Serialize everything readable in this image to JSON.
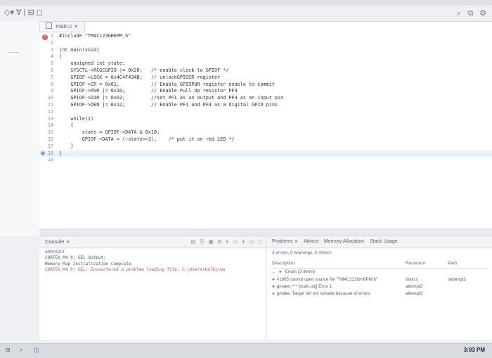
{
  "toolbar": {
    "left_controls": "◇▾ ∀ | ⊟ ◻",
    "right_controls": [
      "⌕",
      "⧉",
      "⚙"
    ]
  },
  "editor": {
    "tab_label": "main.c ⨯",
    "lines": [
      {
        "num": "1",
        "text": "#include \"TM4C123GH6PM.h\""
      },
      {
        "num": "2",
        "text": ""
      },
      {
        "num": "3",
        "text": "int main(void)"
      },
      {
        "num": "4",
        "text": "{"
      },
      {
        "num": "5",
        "text": "    unsigned int state;"
      },
      {
        "num": "6",
        "text": "    SYSCTL->RCGCGPIO |= 0x20;   /* enable clock to GPIOF */"
      },
      {
        "num": "7",
        "text": "    GPIOF->LOCK = 0x4C4F434B;   // unlockGPIOCR register"
      },
      {
        "num": "8",
        "text": "    GPIOF->CR = 0x01;           // Enable GPIOPUR register enable to commit"
      },
      {
        "num": "9",
        "text": "    GPIOF->PUR |= 0x10;         // Enable Pull Up resistor PF4"
      },
      {
        "num": "10",
        "text": "    GPIOF->DIR |= 0x02;         //set PF1 as an output and PF4 as an input pin"
      },
      {
        "num": "11",
        "text": "    GPIOF->DEN |= 0x12;         // Enable PF1 and PF4 as a digital GPIO pins"
      },
      {
        "num": "12",
        "text": ""
      },
      {
        "num": "13",
        "text": "    while(1)"
      },
      {
        "num": "14",
        "text": "    {"
      },
      {
        "num": "15",
        "text": "        state = GPIOF->DATA & 0x10;"
      },
      {
        "num": "16",
        "text": "        GPIOF->DATA = (~state>>3);    /* put it on red LED */"
      },
      {
        "num": "17",
        "text": "    }"
      },
      {
        "num": "18",
        "text": "}"
      },
      {
        "num": "19",
        "text": ""
      }
    ]
  },
  "console": {
    "title": "Console ⨯",
    "subtitle": "attempt3",
    "lines": [
      {
        "text": "CORTEX_M4_0: GEL Output:",
        "type": "normal"
      },
      {
        "text": "Memory Map Initialization Complete",
        "type": "normal"
      },
      {
        "text": "CORTEX_M4_0: GEL: Encountered a problem loading file: C:\\Users\\kelby\\wo",
        "type": "error"
      }
    ],
    "icons": [
      "▤",
      "⎘",
      "▣",
      "⧉",
      "▾",
      "▭",
      "▾",
      "▭",
      "□"
    ]
  },
  "problems": {
    "tabs": [
      "Problems ⨯",
      "Advice",
      "Memory Allocation",
      "Stack Usage"
    ],
    "summary": "3 errors, 0 warnings, 0 others",
    "columns": {
      "description": "Description",
      "resource": "Resource",
      "path": "Path"
    },
    "group": "Errors (3 items)",
    "rows": [
      {
        "description": "#1965 cannot open source file \"TM4C123GH6PM.h\"",
        "resource": "main.c",
        "path": "/attempt3"
      },
      {
        "description": "gmake: *** [main.obj] Error 1",
        "resource": "attempt3",
        "path": ""
      },
      {
        "description": "gmake: Target 'all' not remade because of errors.",
        "resource": "attempt3",
        "path": ""
      }
    ]
  },
  "taskbar": {
    "items": [
      "⊞",
      "⌕",
      "◫"
    ],
    "clock": "3:03 PM"
  }
}
